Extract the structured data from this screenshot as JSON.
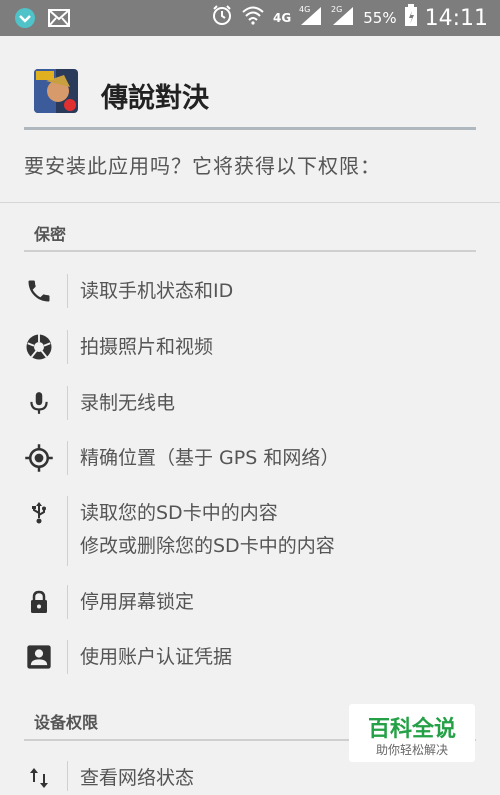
{
  "status_bar": {
    "network_label_1": "4G",
    "network_label_2": "4G",
    "network_label_3": "2G",
    "battery": "55%",
    "time": "14:11"
  },
  "app": {
    "name": "傳說對決"
  },
  "question": "要安装此应用吗？它将获得以下权限：",
  "sections": {
    "privacy": "保密",
    "device": "设备权限"
  },
  "permissions": [
    {
      "icon": "phone-icon",
      "text": "读取手机状态和ID"
    },
    {
      "icon": "camera-aperture-icon",
      "text": "拍摄照片和视频"
    },
    {
      "icon": "microphone-icon",
      "text": "录制无线电"
    },
    {
      "icon": "location-icon",
      "text": "精确位置（基于 GPS 和网络）"
    },
    {
      "icon": "usb-icon",
      "text": "读取您的SD卡中的内容",
      "text2": "修改或删除您的SD卡中的内容"
    },
    {
      "icon": "lock-icon",
      "text": "停用屏幕锁定"
    },
    {
      "icon": "account-box-icon",
      "text": "使用账户认证凭据"
    },
    {
      "icon": "network-arrows-icon",
      "text": "查看网络状态"
    }
  ],
  "watermark": {
    "title": "百科全说",
    "subtitle": "助你轻松解决"
  },
  "colors": {
    "status_bar": "#7d7d7d",
    "background": "#f1f1f1",
    "watermark_green": "#24a146"
  }
}
